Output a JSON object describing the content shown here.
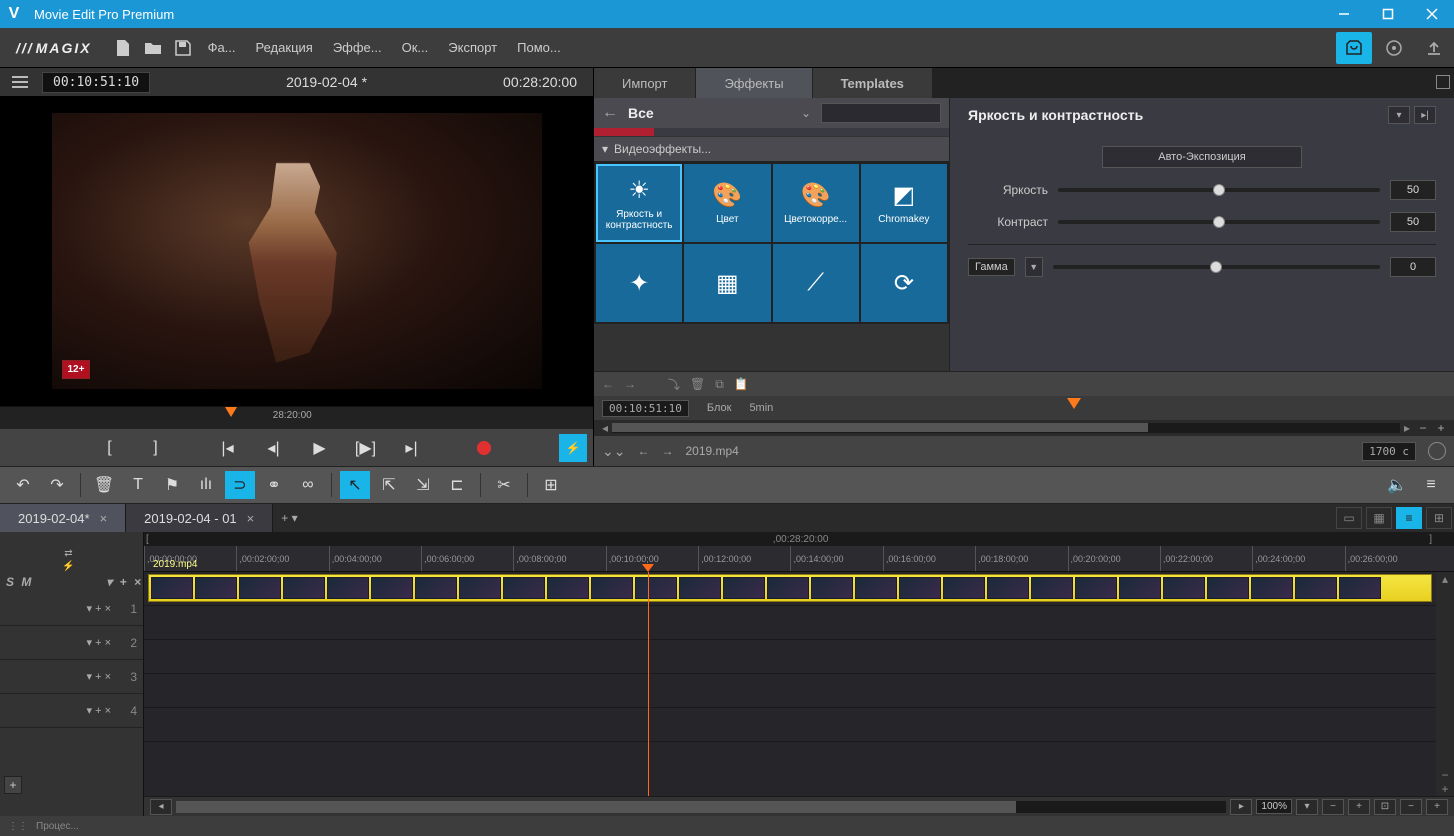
{
  "app": {
    "title": "Movie Edit Pro Premium",
    "brand": "MAGIX"
  },
  "menu": {
    "file": "Фа...",
    "edit": "Редакция",
    "effects": "Эффе...",
    "window": "Ок...",
    "export": "Экспорт",
    "help": "Помо..."
  },
  "preview": {
    "current_tc": "00:10:51:10",
    "project_title": "2019-02-04 *",
    "duration_tc": "00:28:20:00",
    "rating_badge": "12+",
    "scrub_label": "28:20:00"
  },
  "panel_tabs": {
    "import": "Импорт",
    "effects": "Эффекты",
    "templates": "Templates",
    "active": "effects"
  },
  "fx": {
    "all_label": "Все",
    "section": "Видеоэффекты...",
    "tiles": [
      {
        "label": "Яркость и контрастность",
        "active": true
      },
      {
        "label": "Цвет"
      },
      {
        "label": "Цветокорре..."
      },
      {
        "label": "Chromakey"
      },
      {
        "label": ""
      },
      {
        "label": ""
      },
      {
        "label": ""
      },
      {
        "label": ""
      }
    ]
  },
  "fx_controls": {
    "title": "Яркость и контрастность",
    "auto": "Авто-Экспозиция",
    "brightness_label": "Яркость",
    "brightness_value": "50",
    "contrast_label": "Контраст",
    "contrast_value": "50",
    "gamma_label": "Гамма",
    "gamma_value": "0"
  },
  "rp_strip": {
    "tc": "00:10:51:10",
    "block": "Блок",
    "step": "5min"
  },
  "file_strip": {
    "name": "2019.mp4",
    "duration": "1700 c"
  },
  "timeline": {
    "tabs": [
      {
        "label": "2019-02-04*",
        "active": true
      },
      {
        "label": "2019-02-04 - 01"
      }
    ],
    "total_label": ",00:28:20:00",
    "ticks": [
      ",00:00:00;00",
      ",00:02:00;00",
      ",00:04:00;00",
      ",00:06:00;00",
      ",00:08:00;00",
      ",00:10:00;00",
      ",00:12:00;00",
      ",00:14:00;00",
      ",00:16:00;00",
      ",00:18:00;00",
      ",00:20:00;00",
      ",00:22:00;00",
      ",00:24:00;00",
      ",00:26:00;00"
    ],
    "clip_name": "2019.mp4",
    "tracks": [
      "1",
      "2",
      "3",
      "4"
    ],
    "sm_label": "S M",
    "zoom": "100%"
  },
  "statusbar": {
    "process": "Процес..."
  }
}
